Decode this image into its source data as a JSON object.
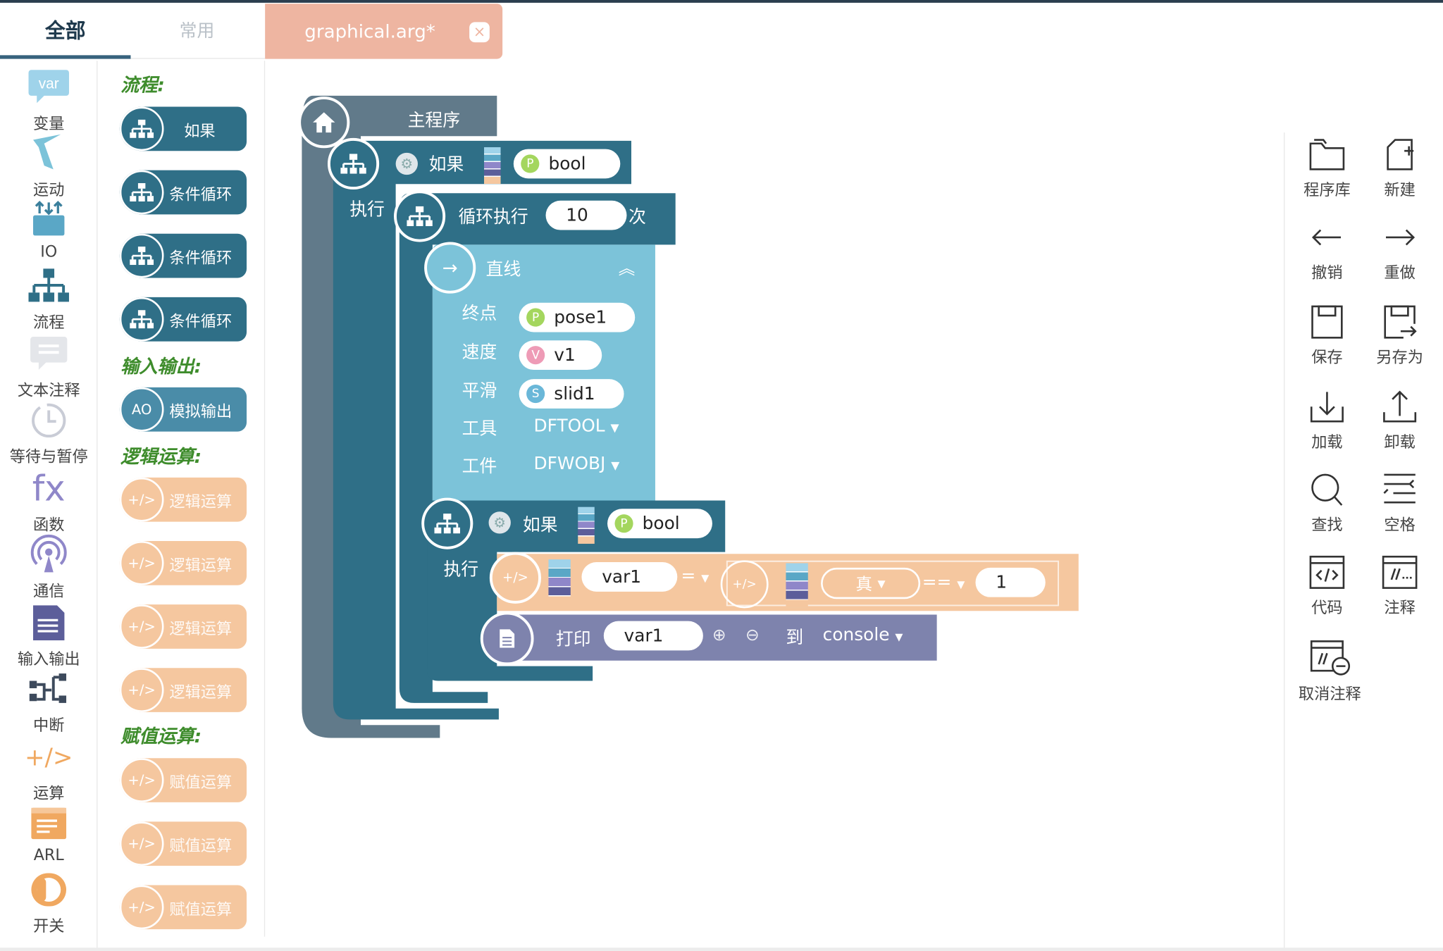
{
  "tabs": {
    "all": "全部",
    "common": "常用"
  },
  "file_tab": {
    "name": "graphical.arg*",
    "close": "×"
  },
  "categories": [
    {
      "name": "变量",
      "icon": "var-icon",
      "icon_text": "var"
    },
    {
      "name": "运动",
      "icon": "motion-icon"
    },
    {
      "name": "IO",
      "icon": "io-icon"
    },
    {
      "name": "流程",
      "icon": "flow-icon"
    },
    {
      "name": "文本注释",
      "icon": "comment-icon"
    },
    {
      "name": "等待与暂停",
      "icon": "clock-icon"
    },
    {
      "name": "函数",
      "icon": "function-icon",
      "icon_text": "fx"
    },
    {
      "name": "通信",
      "icon": "signal-icon"
    },
    {
      "name": "输入输出",
      "icon": "document-icon"
    },
    {
      "name": "中断",
      "icon": "interrupt-icon"
    },
    {
      "name": "运算",
      "icon": "operation-icon",
      "icon_text": "+/>"
    },
    {
      "name": "ARL",
      "icon": "arl-icon"
    },
    {
      "name": "开关",
      "icon": "switch-icon"
    }
  ],
  "palette": {
    "flow_title": "流程:",
    "flow_blocks": [
      "如果",
      "条件循环",
      "条件循环",
      "条件循环"
    ],
    "io_title": "输入输出:",
    "io_block": {
      "badge": "AO",
      "label": "模拟输出"
    },
    "logic_title": "逻辑运算:",
    "logic_blocks": [
      "逻辑运算",
      "逻辑运算",
      "逻辑运算",
      "逻辑运算"
    ],
    "assign_title": "赋值运算:",
    "assign_blocks": [
      "赋值运算",
      "赋值运算",
      "赋值运算"
    ],
    "op_symbol": "+/>"
  },
  "program": {
    "main": "主程序",
    "if1": {
      "label": "如果",
      "param_badge": "P",
      "param": "bool"
    },
    "exec": "执行",
    "loop": {
      "label": "循环执行",
      "count": "10",
      "unit": "次"
    },
    "line": {
      "label": "直线",
      "rows": [
        {
          "label": "终点",
          "badge": "P",
          "value": "pose1"
        },
        {
          "label": "速度",
          "badge": "V",
          "value": "v1"
        },
        {
          "label": "平滑",
          "badge": "S",
          "value": "slid1"
        },
        {
          "label": "工具",
          "value": "DFTOOL"
        },
        {
          "label": "工件",
          "value": "DFWOBJ"
        }
      ]
    },
    "if2": {
      "label": "如果",
      "param_badge": "P",
      "param": "bool"
    },
    "exec2": "执行",
    "cond": {
      "op_symbol": "+/>",
      "left": "var1",
      "op1": "=",
      "true_label": "真",
      "op2": "==",
      "right": "1"
    },
    "print": {
      "label": "打印",
      "var": "var1",
      "to": "到",
      "target": "console"
    }
  },
  "toolbar": [
    {
      "label": "程序库",
      "icon": "folder-icon"
    },
    {
      "label": "新建",
      "icon": "new-file-icon"
    },
    {
      "label": "撤销",
      "icon": "undo-icon"
    },
    {
      "label": "重做",
      "icon": "redo-icon"
    },
    {
      "label": "保存",
      "icon": "save-icon"
    },
    {
      "label": "另存为",
      "icon": "save-as-icon"
    },
    {
      "label": "加载",
      "icon": "download-icon"
    },
    {
      "label": "卸载",
      "icon": "upload-icon"
    },
    {
      "label": "查找",
      "icon": "search-icon"
    },
    {
      "label": "空格",
      "icon": "space-icon"
    },
    {
      "label": "代码",
      "icon": "code-icon"
    },
    {
      "label": "注释",
      "icon": "comment-code-icon"
    },
    {
      "label": "取消注释",
      "icon": "uncomment-icon"
    }
  ],
  "colors": {
    "flow": "#2f6f87",
    "main": "#5f7888",
    "motion": "#7cc3d9",
    "logic": "#f5c79f",
    "print": "#7e83ad",
    "tab": "#eeb5a1",
    "section": "#3e8c2c"
  }
}
